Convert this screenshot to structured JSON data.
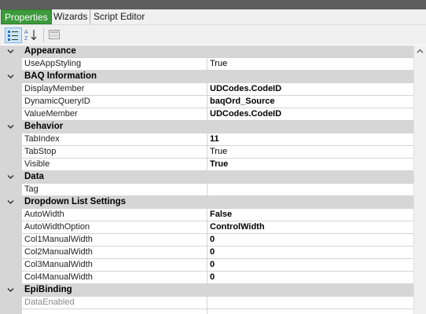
{
  "tabs": [
    {
      "label": "Properties",
      "active": true
    },
    {
      "label": "Wizards",
      "active": false
    },
    {
      "label": "Script Editor",
      "active": false
    }
  ],
  "toolbar": {
    "categorized_icon": "categorized-view-icon",
    "alphabetical_icon": "sort-az-icon",
    "property_pages_icon": "property-pages-icon"
  },
  "colors": {
    "active_tab": "#3c9a3c",
    "category_row": "#d6d6d6",
    "title_bar": "#5e5e5e"
  },
  "groups": [
    {
      "title": "Appearance",
      "props": [
        {
          "name": "UseAppStyling",
          "value": "True",
          "bold": false
        }
      ]
    },
    {
      "title": "BAQ Information",
      "props": [
        {
          "name": "DisplayMember",
          "value": "UDCodes.CodeID",
          "bold": true
        },
        {
          "name": "DynamicQueryID",
          "value": "baqOrd_Source",
          "bold": true
        },
        {
          "name": "ValueMember",
          "value": "UDCodes.CodeID",
          "bold": true
        }
      ]
    },
    {
      "title": "Behavior",
      "props": [
        {
          "name": "TabIndex",
          "value": "11",
          "bold": true
        },
        {
          "name": "TabStop",
          "value": "True",
          "bold": false
        },
        {
          "name": "Visible",
          "value": "True",
          "bold": true
        }
      ]
    },
    {
      "title": "Data",
      "props": [
        {
          "name": "Tag",
          "value": "",
          "bold": false
        }
      ]
    },
    {
      "title": "Dropdown List Settings",
      "props": [
        {
          "name": "AutoWidth",
          "value": "False",
          "bold": true
        },
        {
          "name": "AutoWidthOption",
          "value": "ControlWidth",
          "bold": true
        },
        {
          "name": "Col1ManualWidth",
          "value": "0",
          "bold": true
        },
        {
          "name": "Col2ManualWidth",
          "value": "0",
          "bold": true
        },
        {
          "name": "Col3ManualWidth",
          "value": "0",
          "bold": true
        },
        {
          "name": "Col4ManualWidth",
          "value": "0",
          "bold": true
        }
      ]
    },
    {
      "title": "EpiBinding",
      "props": [
        {
          "name": "DataEnabled",
          "value": "",
          "bold": false,
          "disabled": true
        },
        {
          "name": "",
          "value": "",
          "bold": false
        }
      ]
    }
  ]
}
